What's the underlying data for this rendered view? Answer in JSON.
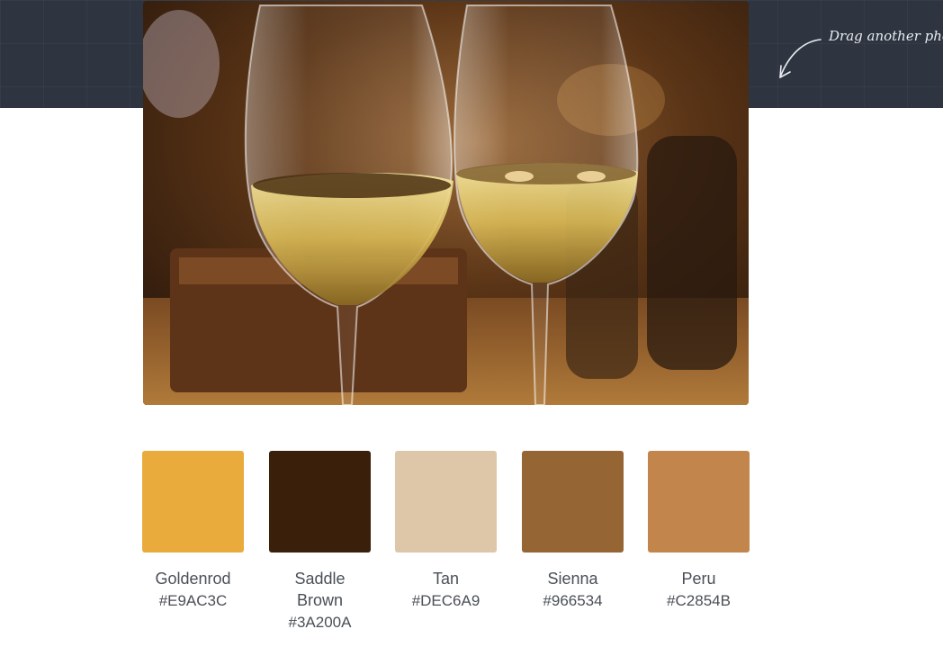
{
  "header": {
    "hint_text": "Drag another pho"
  },
  "photo": {
    "subject": "two glasses of white wine"
  },
  "palette": [
    {
      "name": "Goldenrod",
      "hex": "#E9AC3C",
      "color": "#E9AC3C"
    },
    {
      "name": "Saddle Brown",
      "hex": "#3A200A",
      "color": "#3A200A"
    },
    {
      "name": "Tan",
      "hex": "#DEC6A9",
      "color": "#DEC6A9"
    },
    {
      "name": "Sienna",
      "hex": "#966534",
      "color": "#966534"
    },
    {
      "name": "Peru",
      "hex": "#C2854B",
      "color": "#C2854B"
    }
  ]
}
